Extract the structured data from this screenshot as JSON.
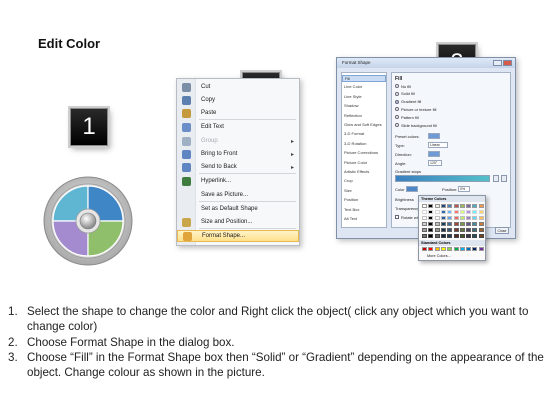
{
  "page": {
    "title": "Edit Color"
  },
  "badges": [
    "1",
    "2",
    "3"
  ],
  "context_menu": {
    "items": [
      {
        "label": "Cut",
        "icon": "scissors-icon",
        "enabled": true,
        "submenu": false
      },
      {
        "label": "Copy",
        "icon": "copy-icon",
        "enabled": true,
        "submenu": false
      },
      {
        "label": "Paste",
        "icon": "paste-icon",
        "enabled": true,
        "submenu": false
      },
      {
        "label": "Edit Text",
        "icon": "edit-text-icon",
        "enabled": true,
        "submenu": false
      },
      {
        "label": "Group",
        "icon": "group-icon",
        "enabled": false,
        "submenu": true
      },
      {
        "label": "Bring to Front",
        "icon": "bring-front-icon",
        "enabled": true,
        "submenu": true
      },
      {
        "label": "Send to Back",
        "icon": "send-back-icon",
        "enabled": true,
        "submenu": true
      },
      {
        "label": "Hyperlink...",
        "icon": "hyperlink-icon",
        "enabled": true,
        "submenu": false
      },
      {
        "label": "Save as Picture...",
        "icon": "",
        "enabled": true,
        "submenu": false
      },
      {
        "label": "Set as Default Shape",
        "icon": "",
        "enabled": true,
        "submenu": false
      },
      {
        "label": "Size and Position...",
        "icon": "size-position-icon",
        "enabled": true,
        "submenu": false
      },
      {
        "label": "Format Shape...",
        "icon": "format-shape-icon",
        "enabled": true,
        "submenu": false,
        "highlighted": true
      }
    ]
  },
  "dialog": {
    "title": "Format Shape",
    "nav": [
      "Fill",
      "Line Color",
      "Line Style",
      "Shadow",
      "Reflection",
      "Glow and Soft Edges",
      "3-D Format",
      "3-D Rotation",
      "Picture Corrections",
      "Picture Color",
      "Artistic Effects",
      "Crop",
      "Size",
      "Position",
      "Text Box",
      "Alt Text"
    ],
    "selected_nav": "Fill",
    "pane_title": "Fill",
    "fill_options": [
      {
        "label": "No fill",
        "selected": false
      },
      {
        "label": "Solid fill",
        "selected": false
      },
      {
        "label": "Gradient fill",
        "selected": true
      },
      {
        "label": "Picture or texture fill",
        "selected": false
      },
      {
        "label": "Pattern fill",
        "selected": false
      },
      {
        "label": "Slide background fill",
        "selected": false
      }
    ],
    "fields": {
      "preset_colors": "Preset colors:",
      "type_label": "Type:",
      "type_value": "Linear",
      "direction_label": "Direction:",
      "angle_label": "Angle:",
      "angle_value": "120°",
      "gradient_stops": "Gradient stops",
      "color_label": "Color",
      "position_label": "Position:",
      "position_value": "0%",
      "brightness_label": "Brightness",
      "transparency_label": "Transparency",
      "rotate_label": "Rotate with shape"
    },
    "close_label": "Close"
  },
  "palette": {
    "theme_header": "Theme Colors",
    "standard_header": "Standard Colors",
    "more_label": "More Colors...",
    "theme_colors": [
      "#ffffff",
      "#000000",
      "#eeece1",
      "#1f497d",
      "#4f81bd",
      "#c0504d",
      "#9bbb59",
      "#8064a2",
      "#4bacc6",
      "#f79646"
    ],
    "standard_colors": [
      "#c00000",
      "#ff0000",
      "#ffc000",
      "#ffff00",
      "#92d050",
      "#00b050",
      "#00b0f0",
      "#0070c0",
      "#002060",
      "#7030a0"
    ]
  },
  "diagram": {
    "quadrant_colors": [
      "#5fb6d3",
      "#3f86c7",
      "#a48bd0",
      "#8fbf6a"
    ]
  },
  "instructions": [
    {
      "num": "1.",
      "text": "Select the shape to change the color and Right click the object( click any object which you want to change color)"
    },
    {
      "num": "2.",
      "text": "Choose Format Shape in the dialog box."
    },
    {
      "num": "3.",
      "text": "Choose “Fill” in the Format Shape box then “Solid” or “Gradient” depending on the appearance of the object. Change colour as shown in the picture."
    }
  ]
}
